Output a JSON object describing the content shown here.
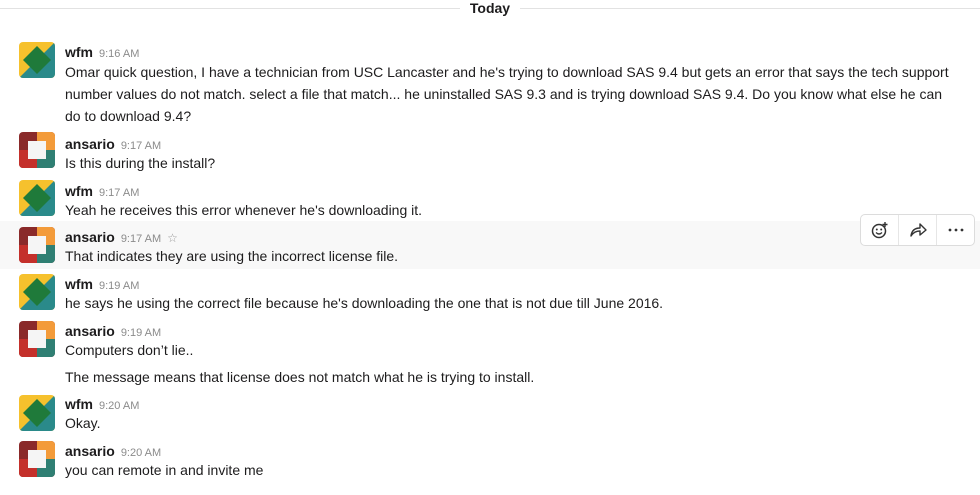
{
  "divider": {
    "label": "Today"
  },
  "messages": [
    {
      "sender": "wfm",
      "time": "9:16 AM",
      "lines": [
        "Omar quick question, I have a technician from USC Lancaster and he's trying to download SAS 9.4 but gets an error that says the tech support number values do not match. select a file that match... he uninstalled SAS 9.3 and is trying download SAS 9.4. Do you know what else he can do to download 9.4?"
      ]
    },
    {
      "sender": "ansario",
      "time": "9:17 AM",
      "lines": [
        "Is this during the install?"
      ]
    },
    {
      "sender": "wfm",
      "time": "9:17 AM",
      "lines": [
        "Yeah he receives this error whenever he's downloading it."
      ]
    },
    {
      "sender": "ansario",
      "time": "9:17 AM",
      "lines": [
        "That indicates they are using the incorrect license file."
      ]
    },
    {
      "sender": "wfm",
      "time": "9:19 AM",
      "lines": [
        "he says he using the correct file because he's downloading the one that is not due till June  2016."
      ]
    },
    {
      "sender": "ansario",
      "time": "9:19 AM",
      "lines": [
        "Computers don’t lie..",
        "The message means that license does not match what he is trying to install."
      ]
    },
    {
      "sender": "wfm",
      "time": "9:20 AM",
      "lines": [
        "Okay."
      ]
    },
    {
      "sender": "ansario",
      "time": "9:20 AM",
      "lines": [
        "you can remote in and invite me"
      ]
    }
  ],
  "hover_actions": {
    "icons": [
      "add-reaction-icon",
      "share-icon",
      "more-actions-icon"
    ]
  },
  "colors": {
    "text": "#1d1c1d",
    "timestamp": "#8b8b8b",
    "hover_bg": "#f8f8f8"
  }
}
